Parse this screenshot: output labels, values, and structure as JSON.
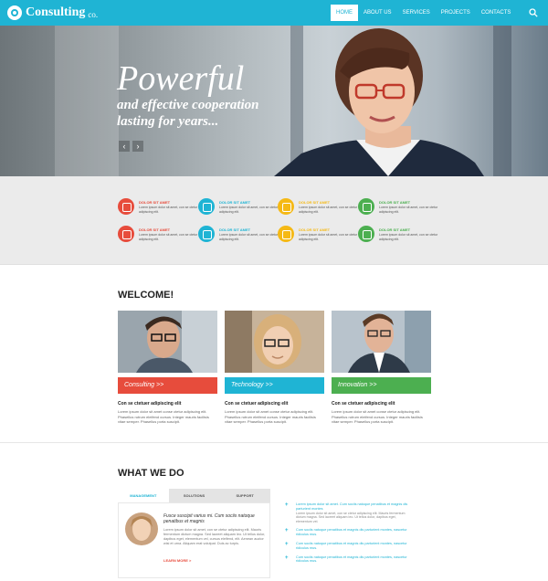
{
  "brand": {
    "name": "Consulting",
    "suffix": "co."
  },
  "nav": {
    "items": [
      "HOME",
      "ABOUT US",
      "SERVICES",
      "PROJECTS",
      "CONTACTS"
    ]
  },
  "hero": {
    "title": "Powerful",
    "subtitle": "and effective cooperation lasting for years...",
    "prev": "‹",
    "next": "›"
  },
  "features": [
    {
      "title": "DOLOR SIT AMET",
      "text": "Lorem ipsum dolor sit amet, con se ctetur adipiscing elit.",
      "color": "#e74c3c",
      "icon": "briefcase-icon"
    },
    {
      "title": "DOLOR SIT AMET",
      "text": "Lorem ipsum dolor sit amet, con se ctetur adipiscing elit.",
      "color": "#1fb4d4",
      "icon": "chart-icon"
    },
    {
      "title": "DOLOR SIT AMET",
      "text": "Lorem ipsum dolor sit amet, con se ctetur adipiscing elit.",
      "color": "#f5b915",
      "icon": "calendar-icon"
    },
    {
      "title": "DOLOR SIT AMET",
      "text": "Lorem ipsum dolor sit amet, con se ctetur adipiscing elit.",
      "color": "#4caf50",
      "icon": "stamp-icon"
    },
    {
      "title": "DOLOR SIT AMET",
      "text": "Lorem ipsum dolor sit amet, con se ctetur adipiscing elit.",
      "color": "#e74c3c",
      "icon": "bar-chart-icon"
    },
    {
      "title": "DOLOR SIT AMET",
      "text": "Lorem ipsum dolor sit amet, con se ctetur adipiscing elit.",
      "color": "#1fb4d4",
      "icon": "paperclip-icon"
    },
    {
      "title": "DOLOR SIT AMET",
      "text": "Lorem ipsum dolor sit amet, con se ctetur adipiscing elit.",
      "color": "#f5b915",
      "icon": "pen-icon"
    },
    {
      "title": "DOLOR SIT AMET",
      "text": "Lorem ipsum dolor sit amet, con se ctetur adipiscing elit.",
      "color": "#4caf50",
      "icon": "line-chart-icon"
    }
  ],
  "welcome": {
    "heading": "WELCOME!",
    "cards": [
      {
        "label": "Consulting >>",
        "color": "#e74c3c",
        "caption": "Con se ctetuer adipiscing elit",
        "text": "Lorem ipsum dolor sit amet conse ctetur adipiscing elit. Phasellus rutrum eleifend cursus. Integer mauris facilisis vitae semper. Phasellus porta suscipit."
      },
      {
        "label": "Technology >>",
        "color": "#1fb4d4",
        "caption": "Con se ctetuer adipiscing elit",
        "text": "Lorem ipsum dolor sit amet conse ctetur adipiscing elit. Phasellus rutrum eleifend cursus. Integer mauris facilisis vitae semper. Phasellus porta suscipit."
      },
      {
        "label": "Innovation >>",
        "color": "#4caf50",
        "caption": "Con se ctetuer adipiscing elit",
        "text": "Lorem ipsum dolor sit amet conse ctetur adipiscing elit. Phasellus rutrum eleifend cursus. Integer mauris facilisis vitae semper. Phasellus porta suscipit."
      }
    ]
  },
  "whatwedo": {
    "heading": "WHAT WE DO",
    "tabs": [
      "MANAGEMENT",
      "SOLUTIONS",
      "SUPPORT"
    ],
    "panel": {
      "title": "Fusce suscipit varius mi. Cum sociis natoque penatibus et magnis",
      "text": "Lorem ipsum dolor sit amet, con se ctetur adipiscing elit. Mauris fermentum dictum magna. Sed laoreet aliquam leo. Ut tellus dolor, dapibus eget, elementum vel, cursus eleifend, elit. Aenean auctor wisi et urna. Aliquam erat volutpat. Duis ac turpis.",
      "more": "LEARN MORE >"
    },
    "list": [
      {
        "title": "Lorem ipsum dolor sit amet. Cum sociis natoque penatibus et magnis dis parturient montes",
        "text": "Lorem ipsum dolor sit amet, con se ctetur adipiscing elit. Mauris fermentum dictum magna. Sed laoreet aliquam leo. Ut tellus dolor, dapibus eget, elementum vel."
      },
      {
        "title": "Cum sociis natoque penatibus et magnis dis parturient montes, nascetur ridiculus mus.",
        "text": ""
      },
      {
        "title": "Cum sociis natoque penatibus et magnis dis parturient montes, nascetur ridiculus mus.",
        "text": ""
      },
      {
        "title": "Cum sociis natoque penatibus et magnis dis parturient montes, nascetur ridiculus mus.",
        "text": ""
      }
    ]
  }
}
